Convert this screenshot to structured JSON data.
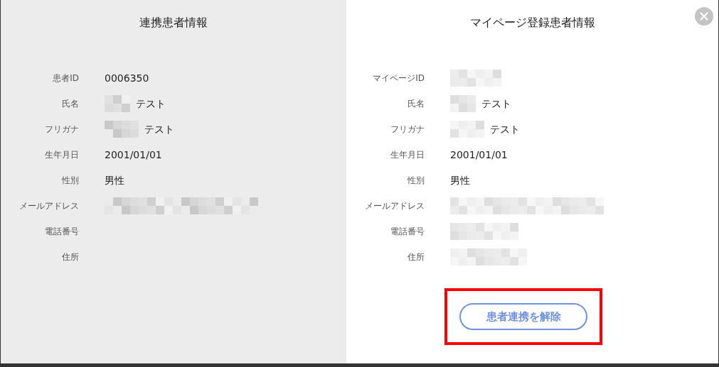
{
  "panels": [
    {
      "title": "連携患者情報",
      "rows": [
        {
          "label": "患者ID",
          "kind": "text",
          "value": "0006350"
        },
        {
          "label": "氏名",
          "kind": "redacted_text",
          "value": "テスト"
        },
        {
          "label": "フリガナ",
          "kind": "redacted_text",
          "value": "テスト"
        },
        {
          "label": "生年月日",
          "kind": "text",
          "value": "2001/01/01"
        },
        {
          "label": "性別",
          "kind": "text",
          "value": "男性"
        },
        {
          "label": "メールアドレス",
          "kind": "redacted"
        },
        {
          "label": "電話番号",
          "kind": "empty"
        },
        {
          "label": "住所",
          "kind": "empty"
        }
      ]
    },
    {
      "title": "マイページ登録患者情報",
      "rows": [
        {
          "label": "マイページID",
          "kind": "redacted"
        },
        {
          "label": "氏名",
          "kind": "redacted_text",
          "value": "テスト"
        },
        {
          "label": "フリガナ",
          "kind": "redacted_text",
          "value": "テスト"
        },
        {
          "label": "生年月日",
          "kind": "text",
          "value": "2001/01/01"
        },
        {
          "label": "性別",
          "kind": "text",
          "value": "男性"
        },
        {
          "label": "メールアドレス",
          "kind": "redacted"
        },
        {
          "label": "電話番号",
          "kind": "redacted"
        },
        {
          "label": "住所",
          "kind": "redacted"
        }
      ],
      "button": {
        "label": "患者連携を解除",
        "highlighted": true
      }
    }
  ]
}
